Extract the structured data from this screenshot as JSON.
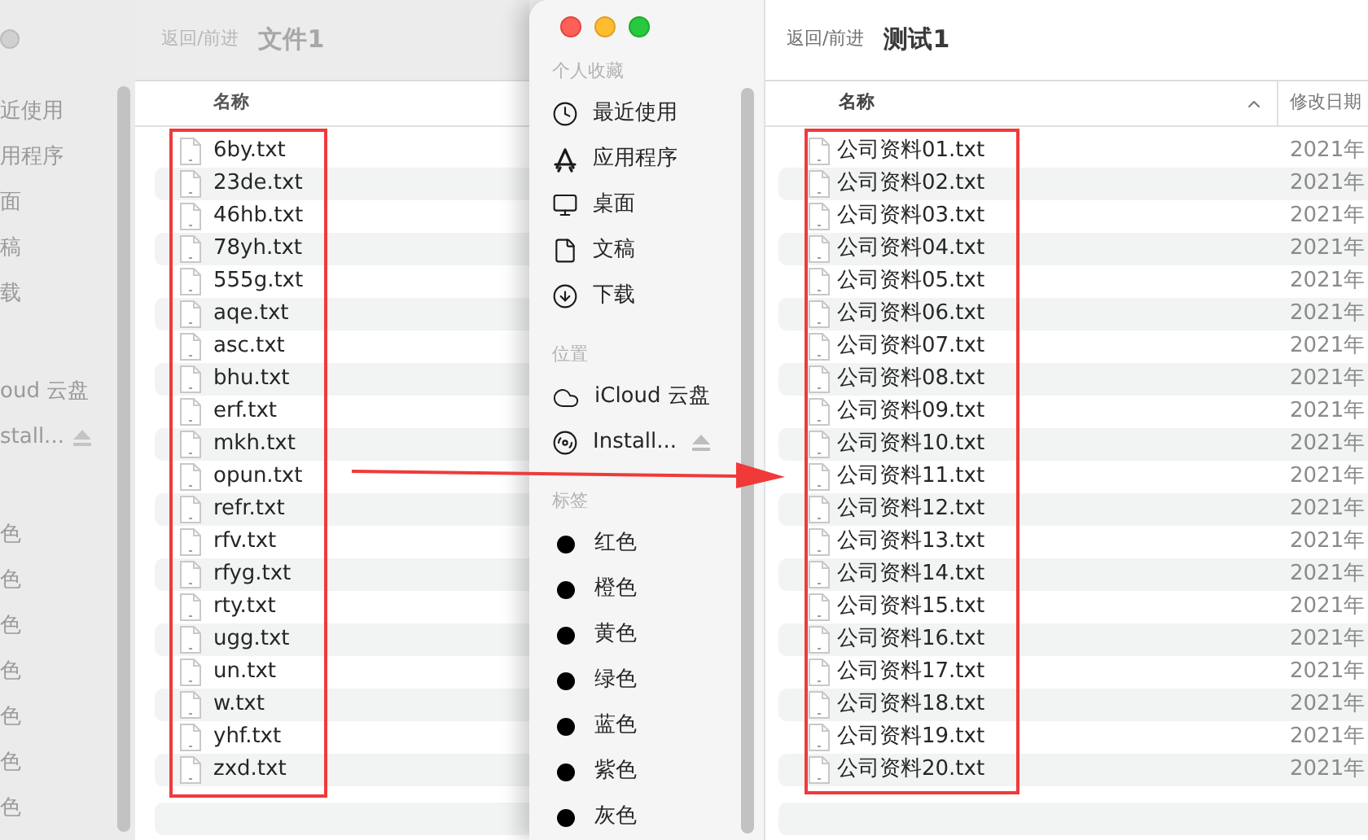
{
  "back_window": {
    "nav_label": "返回/前进",
    "title": "文件1",
    "sidebar": {
      "sections": [
        {
          "items": [
            {
              "label": "近使用",
              "kind": "plain"
            },
            {
              "label": "用程序",
              "kind": "plain"
            },
            {
              "label": "面",
              "kind": "plain"
            },
            {
              "label": "稿",
              "kind": "plain"
            },
            {
              "label": "载",
              "kind": "plain"
            }
          ]
        },
        {
          "items": [
            {
              "label": "oud 云盘",
              "kind": "plain"
            },
            {
              "label": "stall...",
              "kind": "ejectable"
            }
          ]
        },
        {
          "items": [
            {
              "label": "色",
              "kind": "plain"
            },
            {
              "label": "色",
              "kind": "plain"
            },
            {
              "label": "色",
              "kind": "plain"
            },
            {
              "label": "色",
              "kind": "plain"
            },
            {
              "label": "色",
              "kind": "plain"
            },
            {
              "label": "色",
              "kind": "plain"
            },
            {
              "label": "色",
              "kind": "plain"
            }
          ]
        }
      ]
    },
    "table": {
      "columns": [
        {
          "label": "名称"
        }
      ],
      "rows": [
        {
          "name": "6by.txt"
        },
        {
          "name": "23de.txt"
        },
        {
          "name": "46hb.txt"
        },
        {
          "name": "78yh.txt"
        },
        {
          "name": "555g.txt"
        },
        {
          "name": "aqe.txt"
        },
        {
          "name": "asc.txt"
        },
        {
          "name": "bhu.txt"
        },
        {
          "name": "erf.txt"
        },
        {
          "name": "mkh.txt"
        },
        {
          "name": "opun.txt"
        },
        {
          "name": "refr.txt"
        },
        {
          "name": "rfv.txt"
        },
        {
          "name": "rfyg.txt"
        },
        {
          "name": "rty.txt"
        },
        {
          "name": "ugg.txt"
        },
        {
          "name": "un.txt"
        },
        {
          "name": "w.txt"
        },
        {
          "name": "yhf.txt"
        },
        {
          "name": "zxd.txt"
        }
      ]
    }
  },
  "front_window": {
    "nav_label": "返回/前进",
    "title": "测试1",
    "sidebar": {
      "sections": [
        {
          "title": "个人收藏",
          "items": [
            {
              "label": "最近使用",
              "kind": "clock"
            },
            {
              "label": "应用程序",
              "kind": "apps"
            },
            {
              "label": "桌面",
              "kind": "desktop"
            },
            {
              "label": "文稿",
              "kind": "document"
            },
            {
              "label": "下载",
              "kind": "download"
            }
          ]
        },
        {
          "title": "位置",
          "items": [
            {
              "label": "iCloud 云盘",
              "kind": "cloud"
            },
            {
              "label": "Install...",
              "kind": "disk"
            }
          ]
        },
        {
          "title": "标签",
          "items": [
            {
              "label": "红色",
              "kind": "tag"
            },
            {
              "label": "橙色",
              "kind": "tag"
            },
            {
              "label": "黄色",
              "kind": "tag"
            },
            {
              "label": "绿色",
              "kind": "tag"
            },
            {
              "label": "蓝色",
              "kind": "tag"
            },
            {
              "label": "紫色",
              "kind": "tag"
            },
            {
              "label": "灰色",
              "kind": "tag"
            }
          ]
        }
      ]
    },
    "table": {
      "columns": [
        {
          "label": "名称",
          "sorted": true
        },
        {
          "label": "修改日期",
          "sorted": false
        }
      ],
      "rows": [
        {
          "name": "公司资料01.txt",
          "date": "2021年"
        },
        {
          "name": "公司资料02.txt",
          "date": "2021年"
        },
        {
          "name": "公司资料03.txt",
          "date": "2021年"
        },
        {
          "name": "公司资料04.txt",
          "date": "2021年"
        },
        {
          "name": "公司资料05.txt",
          "date": "2021年"
        },
        {
          "name": "公司资料06.txt",
          "date": "2021年"
        },
        {
          "name": "公司资料07.txt",
          "date": "2021年"
        },
        {
          "name": "公司资料08.txt",
          "date": "2021年"
        },
        {
          "name": "公司资料09.txt",
          "date": "2021年"
        },
        {
          "name": "公司资料10.txt",
          "date": "2021年"
        },
        {
          "name": "公司资料11.txt",
          "date": "2021年"
        },
        {
          "name": "公司资料12.txt",
          "date": "2021年"
        },
        {
          "name": "公司资料13.txt",
          "date": "2021年"
        },
        {
          "name": "公司资料14.txt",
          "date": "2021年"
        },
        {
          "name": "公司资料15.txt",
          "date": "2021年"
        },
        {
          "name": "公司资料16.txt",
          "date": "2021年"
        },
        {
          "name": "公司资料17.txt",
          "date": "2021年"
        },
        {
          "name": "公司资料18.txt",
          "date": "2021年"
        },
        {
          "name": "公司资料19.txt",
          "date": "2021年"
        },
        {
          "name": "公司资料20.txt",
          "date": "2021年"
        }
      ]
    }
  }
}
